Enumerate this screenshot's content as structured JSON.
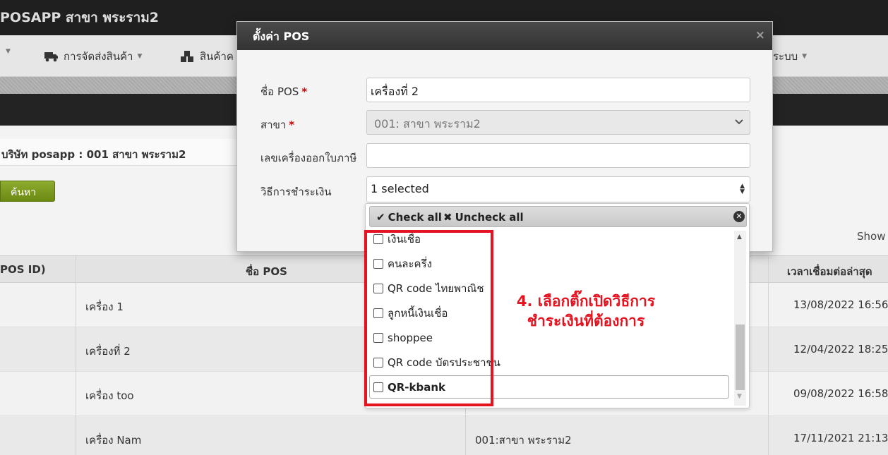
{
  "app": {
    "title": "POSAPP สาขา พระราม2"
  },
  "menu": {
    "items": [
      {
        "label": "",
        "icon": "caret-only"
      },
      {
        "label": "การจัดส่งสินค้า",
        "icon": "truck-icon"
      },
      {
        "label": "สินค้าค",
        "icon": "boxes-icon"
      },
      {
        "label": "ระบบ",
        "icon": ""
      }
    ]
  },
  "filter": {
    "company_label": "บริษัท posapp : 001 สาขา พระราม2",
    "search_button": "ค้นหา",
    "show_label": "Show"
  },
  "table": {
    "headers": [
      "POS ID)",
      "ชื่อ POS",
      "เวลาเชื่อมต่อล่าสุด"
    ],
    "rows": [
      {
        "name": "เครื่อง 1",
        "branch": "",
        "last_connect": "13/08/2022 16:56"
      },
      {
        "name": "เครื่องที่ 2",
        "branch": "",
        "last_connect": "12/04/2022 18:25"
      },
      {
        "name": "เครื่อง too",
        "branch": "",
        "last_connect": "09/08/2022 16:58"
      },
      {
        "name": "เครื่อง Nam",
        "branch": "001:สาขา พระราม2",
        "last_connect": "17/11/2021 21:13"
      }
    ]
  },
  "modal": {
    "title": "ตั้งค่า POS",
    "close_glyph": "×",
    "required_mark": "*",
    "fields": {
      "pos_name": {
        "label": "ชื่อ POS",
        "value": "เครื่องที่ 2"
      },
      "branch": {
        "label": "สาขา",
        "value": "001: สาขา พระราม2"
      },
      "tax_machine": {
        "label": "เลขเครื่องออกใบภาษี",
        "value": ""
      },
      "payment": {
        "label": "วิธีการชำระเงิน",
        "value": "1 selected"
      }
    },
    "multiselect": {
      "check_all": "Check all",
      "uncheck_all": "Uncheck all",
      "options": [
        {
          "label": "เงินเชื่อ",
          "checked": false
        },
        {
          "label": "คนละครึ่ง",
          "checked": false
        },
        {
          "label": "QR code ไทยพาณิช",
          "checked": false
        },
        {
          "label": "ลูกหนี้เงินเชื่อ",
          "checked": false
        },
        {
          "label": "shoppee",
          "checked": false
        },
        {
          "label": "QR code บัตรประชาชน",
          "checked": false
        },
        {
          "label": "QR-kbank",
          "checked": false
        }
      ]
    }
  },
  "annotation": {
    "line1": "4. เลือกติ๊กเปิดวิธีการ",
    "line2": "ชำระเงินที่ต้องการ",
    "color": "#e3131f"
  }
}
